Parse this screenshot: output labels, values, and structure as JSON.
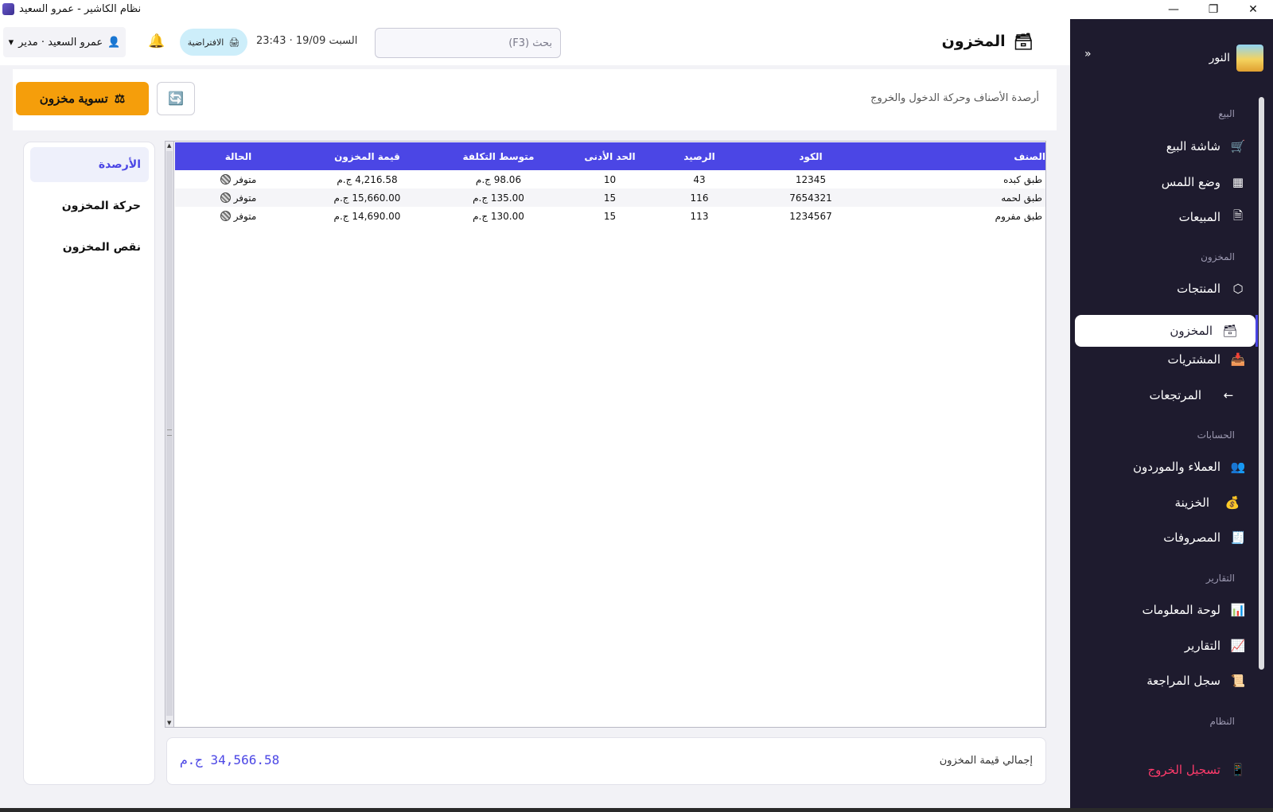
{
  "window": {
    "title": "نظام الكاشير - عمرو السعيد"
  },
  "sidebar": {
    "brand": "النور",
    "collapse_icon": "»",
    "sections": {
      "sales": "البيع",
      "inventory": "المخزون",
      "accounts": "الحسابات",
      "reports": "التقارير",
      "system": "النظام"
    },
    "items": [
      {
        "label": "شاشة البيع",
        "icon": "cart-icon"
      },
      {
        "label": "وضع اللمس",
        "icon": "calculator-icon"
      },
      {
        "label": "المبيعات",
        "icon": "document-icon"
      },
      {
        "label": "المنتجات",
        "icon": "box-icon"
      },
      {
        "label": "المخزون",
        "icon": "archive-icon"
      },
      {
        "label": "المشتريات",
        "icon": "inbox-download-icon"
      },
      {
        "label": "المرتجعات",
        "icon": "arrow-left-icon"
      },
      {
        "label": "العملاء والموردون",
        "icon": "users-icon"
      },
      {
        "label": "الخزينة",
        "icon": "money-bag-icon"
      },
      {
        "label": "المصروفات",
        "icon": "receipt-icon"
      },
      {
        "label": "لوحة المعلومات",
        "icon": "bar-chart-icon"
      },
      {
        "label": "التقارير",
        "icon": "line-chart-icon"
      },
      {
        "label": "سجل المراجعة",
        "icon": "scroll-icon"
      }
    ],
    "logout": "تسجيل الخروج",
    "active_item": "المخزون"
  },
  "header": {
    "page_title": "المخزون",
    "search_placeholder": "بحث (F3)",
    "datetime": "السبت 19/09 · 23:43",
    "printer_label": "الافتراضية",
    "user_label": "عمرو السعيد · مدير"
  },
  "toolbar": {
    "subtitle": "أرصدة الأصناف وحركة الدخول والخروج",
    "adjust_label": "تسوية مخزون"
  },
  "tabs": [
    {
      "label": "الأرصدة",
      "active": true
    },
    {
      "label": "حركة المخزون",
      "active": false
    },
    {
      "label": "نقص المخزون",
      "active": false
    }
  ],
  "table": {
    "columns": [
      "الصنف",
      "الكود",
      "الرصيد",
      "الحد الأدنى",
      "متوسط التكلفة",
      "قيمة المخزون",
      "الحالة"
    ],
    "rows": [
      {
        "item": "طبق كبده",
        "code": "12345",
        "balance": "43",
        "min": "10",
        "avg_cost": "98.06 ج.م",
        "value": "4,216.58 ج.م",
        "status": "متوفر"
      },
      {
        "item": "طبق لحمه",
        "code": "7654321",
        "balance": "116",
        "min": "15",
        "avg_cost": "135.00 ج.م",
        "value": "15,660.00 ج.م",
        "status": "متوفر"
      },
      {
        "item": "طبق مفروم",
        "code": "1234567",
        "balance": "113",
        "min": "15",
        "avg_cost": "130.00 ج.م",
        "value": "14,690.00 ج.م",
        "status": "متوفر"
      }
    ]
  },
  "footer": {
    "total_label": "إجمالي قيمة المخزون",
    "total_value": "34,566.58 ج.م"
  },
  "colors": {
    "accent": "#4b46e5",
    "sidebar_bg": "#1e1b2e",
    "adjust_button": "#f59e0b",
    "logout": "#ff3b6b",
    "printer_pill": "#cdeefa"
  }
}
